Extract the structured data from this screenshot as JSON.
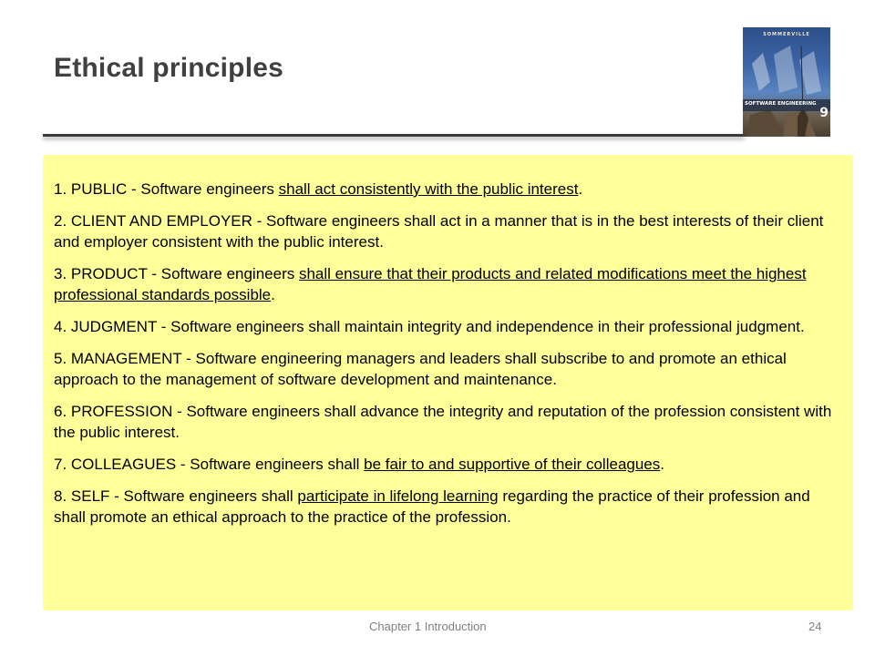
{
  "slide": {
    "title": "Ethical principles"
  },
  "book_cover": {
    "author": "SOMMERVILLE",
    "title": "SOFTWARE ENGINEERING",
    "edition": "9"
  },
  "principles": [
    {
      "lead": "1. PUBLIC - Software engineers ",
      "underlined": "shall act consistently with the public interest",
      "tail": "."
    },
    {
      "lead": "2. CLIENT AND EMPLOYER - Software engineers shall act in a manner that is in the best interests of their client and employer consistent with the public interest.",
      "underlined": "",
      "tail": ""
    },
    {
      "lead": "3. PRODUCT - Software engineers ",
      "underlined": "shall ensure that their products and related modifications meet the highest professional standards possible",
      "tail": "."
    },
    {
      "lead": "4. JUDGMENT - Software engineers shall maintain integrity and independence in their professional judgment.",
      "underlined": "",
      "tail": ""
    },
    {
      "lead": "5. MANAGEMENT - Software engineering managers and leaders shall subscribe to and promote an ethical approach to the management of software development and maintenance.",
      "underlined": "",
      "tail": ""
    },
    {
      "lead": "6. PROFESSION - Software engineers shall advance the integrity and reputation of the profession consistent with the public interest.",
      "underlined": "",
      "tail": ""
    },
    {
      "lead": "7. COLLEAGUES - Software engineers shall ",
      "underlined": "be fair to and supportive of their colleagues",
      "tail": "."
    },
    {
      "lead": "8. SELF - Software engineers shall ",
      "underlined": "participate in lifelong learning",
      "tail": " regarding the practice of their profession and shall promote an ethical approach to the practice of the profession."
    }
  ],
  "footer": {
    "chapter": "Chapter 1 Introduction",
    "page": "24"
  },
  "colors": {
    "content_background": "#ffff99",
    "title_text": "#404040",
    "footer_text": "#808080"
  }
}
